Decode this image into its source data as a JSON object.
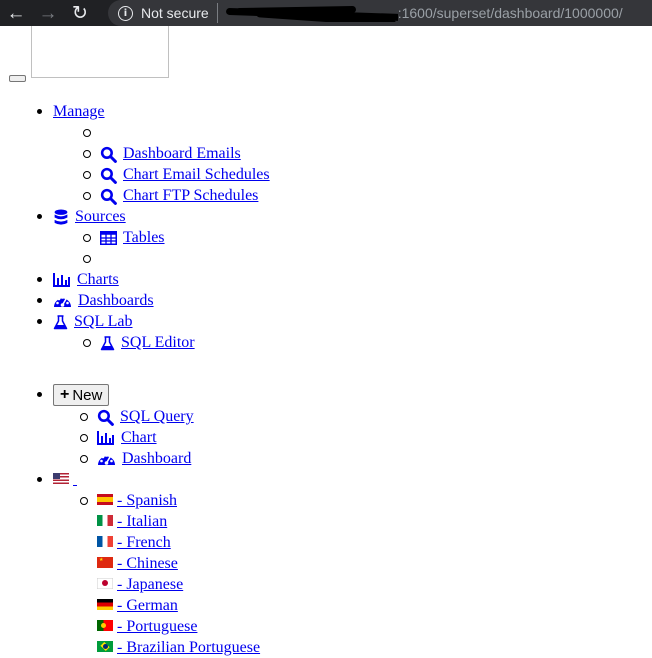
{
  "browser": {
    "security_label": "Not secure",
    "url_visible": ":1600/superset/dashboard/1000000/"
  },
  "menu": {
    "manage": {
      "label": "Manage",
      "items": [
        {
          "label": "",
          "icon": "search-icon"
        },
        {
          "label": "Dashboard Emails",
          "icon": "search-icon"
        },
        {
          "label": "Chart Email Schedules",
          "icon": "search-icon"
        },
        {
          "label": "Chart FTP Schedules",
          "icon": "search-icon"
        }
      ]
    },
    "sources": {
      "label": "Sources",
      "icon": "database-icon",
      "items": [
        {
          "label": "Tables",
          "icon": "table-icon"
        },
        {
          "label": ""
        }
      ]
    },
    "charts": {
      "label": "Charts",
      "icon": "bar-chart-icon"
    },
    "dashboards": {
      "label": "Dashboards",
      "icon": "dashboard-icon"
    },
    "sql_lab": {
      "label": "SQL Lab",
      "icon": "flask-icon",
      "items": [
        {
          "label": "SQL Editor",
          "icon": "flask-icon"
        }
      ]
    }
  },
  "new_menu": {
    "button_label": "New",
    "items": [
      {
        "label": "SQL Query",
        "icon": "search-icon"
      },
      {
        "label": "Chart",
        "icon": "bar-chart-icon"
      },
      {
        "label": "Dashboard",
        "icon": "dashboard-icon"
      }
    ]
  },
  "language": {
    "current_icon": "flag-us-icon",
    "items": [
      {
        "label": "- Spanish",
        "icon": "flag-es-icon"
      },
      {
        "label": "- Italian",
        "icon": "flag-it-icon"
      },
      {
        "label": "- French",
        "icon": "flag-fr-icon"
      },
      {
        "label": "- Chinese",
        "icon": "flag-cn-icon"
      },
      {
        "label": "- Japanese",
        "icon": "flag-jp-icon"
      },
      {
        "label": "- German",
        "icon": "flag-de-icon"
      },
      {
        "label": "- Portuguese",
        "icon": "flag-pt-icon"
      },
      {
        "label": "- Brazilian Portuguese",
        "icon": "flag-br-icon"
      }
    ]
  },
  "colors": {
    "link": "#0000ee",
    "chrome_bg": "#202124",
    "omnibox_bg": "#35363a"
  }
}
